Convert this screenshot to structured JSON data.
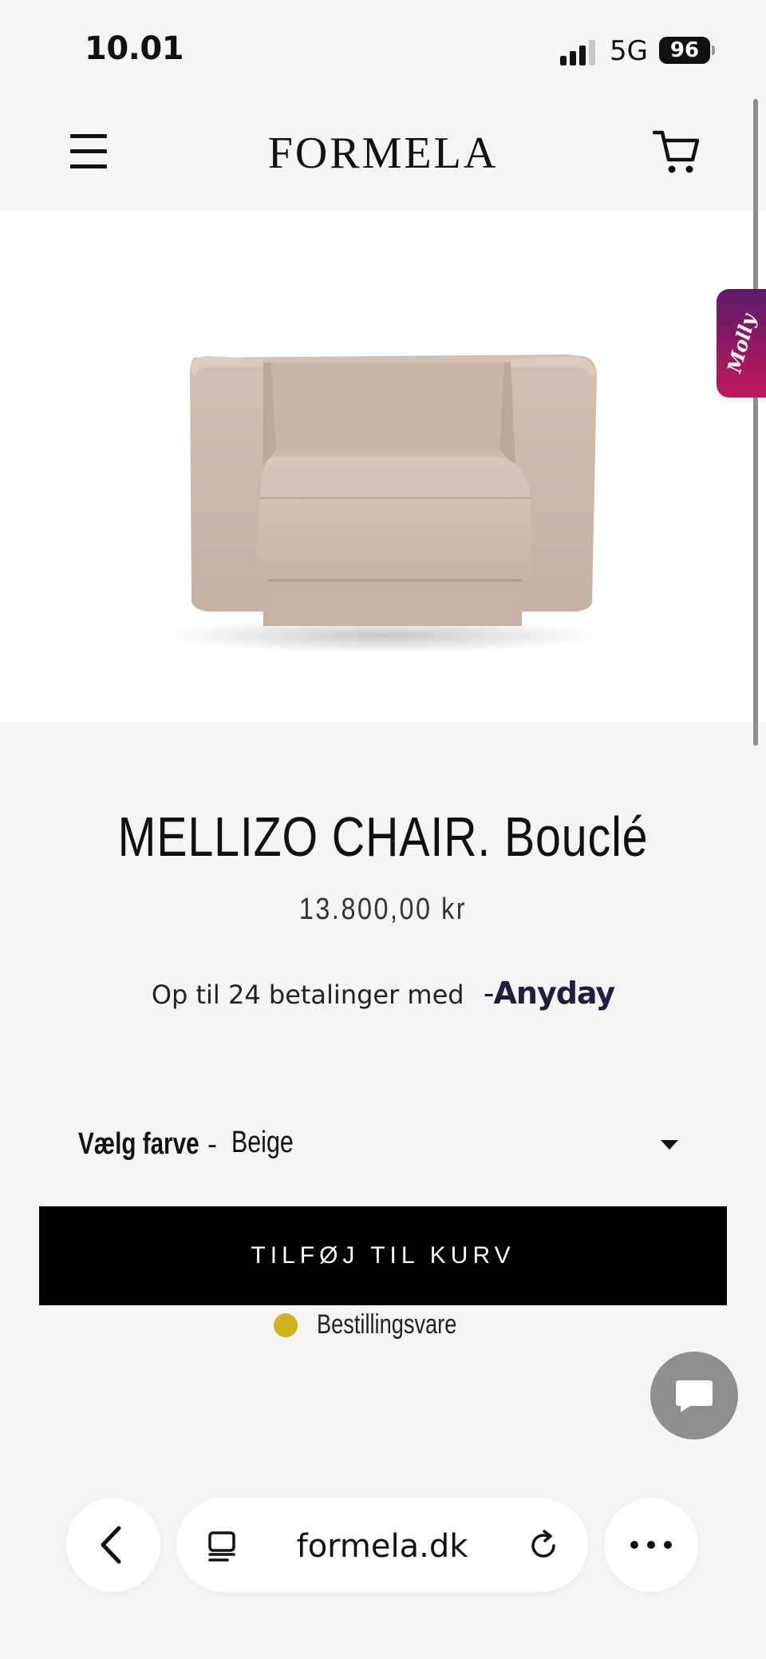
{
  "status_bar": {
    "time": "10.01",
    "network": "5G",
    "battery": "96",
    "icons": [
      "signal-bars-icon",
      "battery-icon"
    ]
  },
  "header": {
    "logo": "FORMELA",
    "icons": [
      "menu-icon",
      "cart-icon"
    ]
  },
  "side_tab": {
    "label": "Molly"
  },
  "product": {
    "image_icon": "armchair-image",
    "title": "MELLIZO CHAIR. Bouclé",
    "price": "13.800,00 kr",
    "installments_text": "Op til 24 betalinger med",
    "installments_provider": "Anyday",
    "variant": {
      "label": "Vælg farve",
      "separator": "-",
      "selected": "Beige"
    },
    "add_to_cart_label": "TILFØJ TIL KURV",
    "stock_status": "Bestillingsvare",
    "stock_color": "#d4b21e"
  },
  "chat": {
    "icon": "chat-bubble-icon"
  },
  "browser": {
    "url": "formela.dk",
    "icons": [
      "back-chevron-icon",
      "tabs-icon",
      "reload-icon",
      "more-icon"
    ]
  }
}
